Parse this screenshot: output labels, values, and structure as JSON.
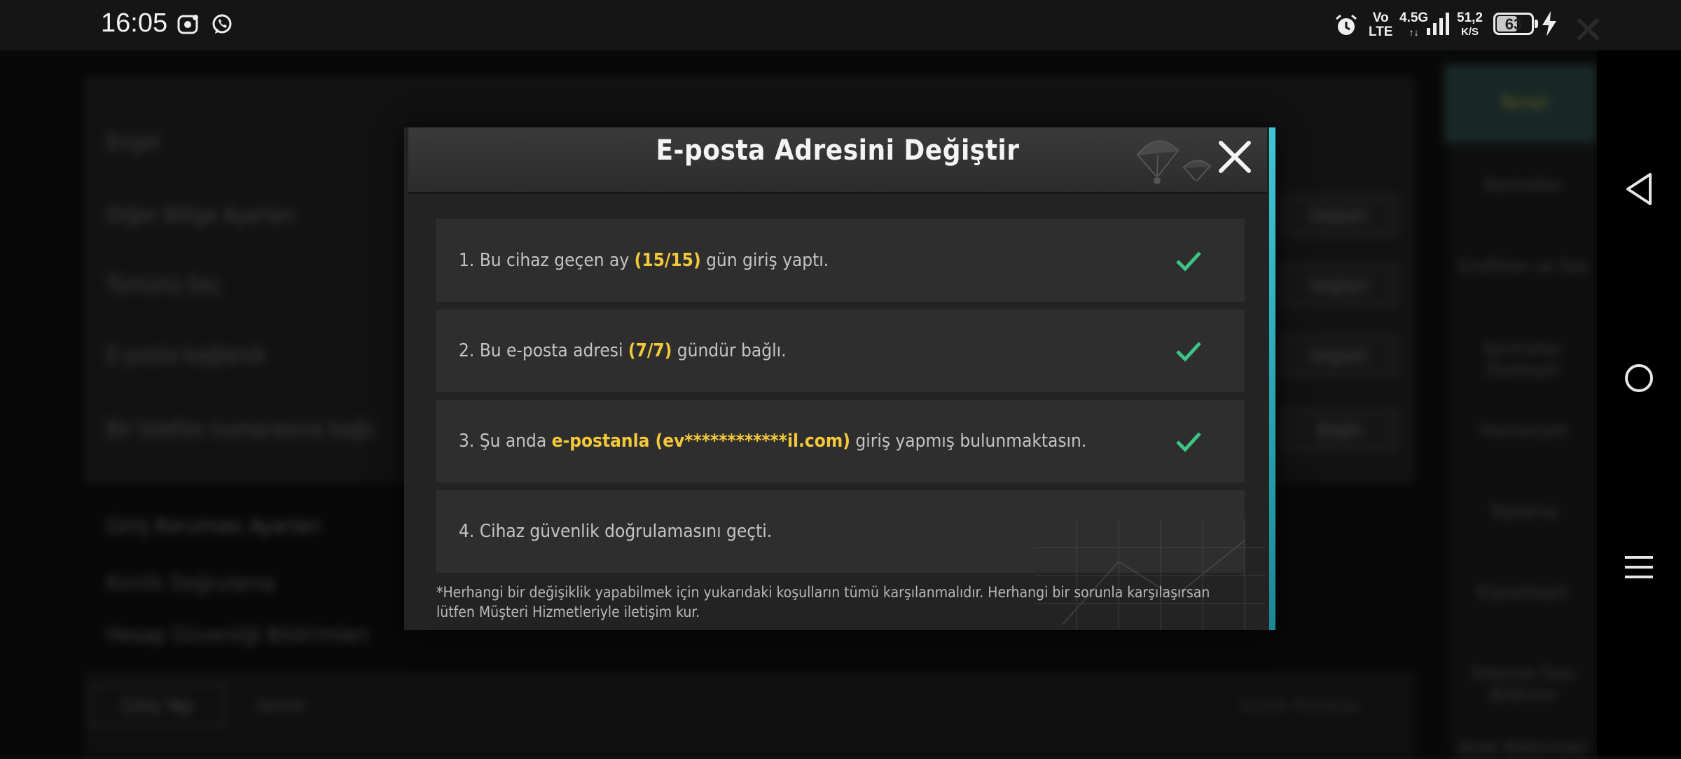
{
  "status_bar": {
    "time": "16:05",
    "app_icons": [
      "screen-recorder-icon",
      "whatsapp-icon"
    ],
    "volte_top": "Vo",
    "volte_bottom": "LTE",
    "network": "4.5G",
    "speed_value": "51,2",
    "speed_unit": "K/S",
    "battery": "63",
    "battery_level_pct": 63
  },
  "background": {
    "rows": [
      "Engel",
      "Diğer Bölge Ayarları",
      "Tümünü Seç",
      "E-posta bağlandı",
      "Bir telefon numarasına bağlı",
      "Giriş Koruması Ayarları",
      "Kimlik Doğrulama",
      "Hesap Güvenliği Bildirimleri"
    ],
    "buttons": [
      "Değiştir",
      "Değiştir",
      "Değiştir",
      "Bağla"
    ],
    "sidebar": [
      "Temel",
      "Kontroller",
      "Grafikler ve Ses",
      "Kontroller Özelleştir",
      "Hassasiyet",
      "Toplama",
      "Kişiselleştir",
      "İnternet Sesi Bildirimi",
      "Anlık Bildirimler"
    ],
    "bottom": {
      "logout": "Çıkış Yap",
      "version_label": "Sürüm",
      "right_text": "Gizlilik Politikası"
    }
  },
  "modal": {
    "title": "E-posta Adresini Değiştir",
    "conditions": [
      {
        "before": "1. Bu cihaz geçen ay ",
        "highlight": "(15/15)",
        "after": " gün giriş yaptı.",
        "checked": true
      },
      {
        "before": "2. Bu e-posta adresi ",
        "highlight": "(7/7)",
        "after": " gündür bağlı.",
        "checked": true
      },
      {
        "before": "3. Şu anda ",
        "highlight": "e-postanla (ev************il.com)",
        "after": " giriş yapmış bulunmaktasın.",
        "checked": true
      },
      {
        "before": "4. Cihaz güvenlik doğrulamasını geçti.",
        "highlight": "",
        "after": "",
        "checked": false
      }
    ],
    "footnote": "*Herhangi bir değişiklik yapabilmek için yukarıdaki koşulların tümü karşılanmalıdır. Herhangi bir sorunla karşılaşırsan lütfen Müşteri Hizmetleriyle iletişim kur."
  },
  "colors": {
    "highlight": "#f3c93a",
    "check": "#3ec486",
    "accent": "#3fc6d6"
  }
}
